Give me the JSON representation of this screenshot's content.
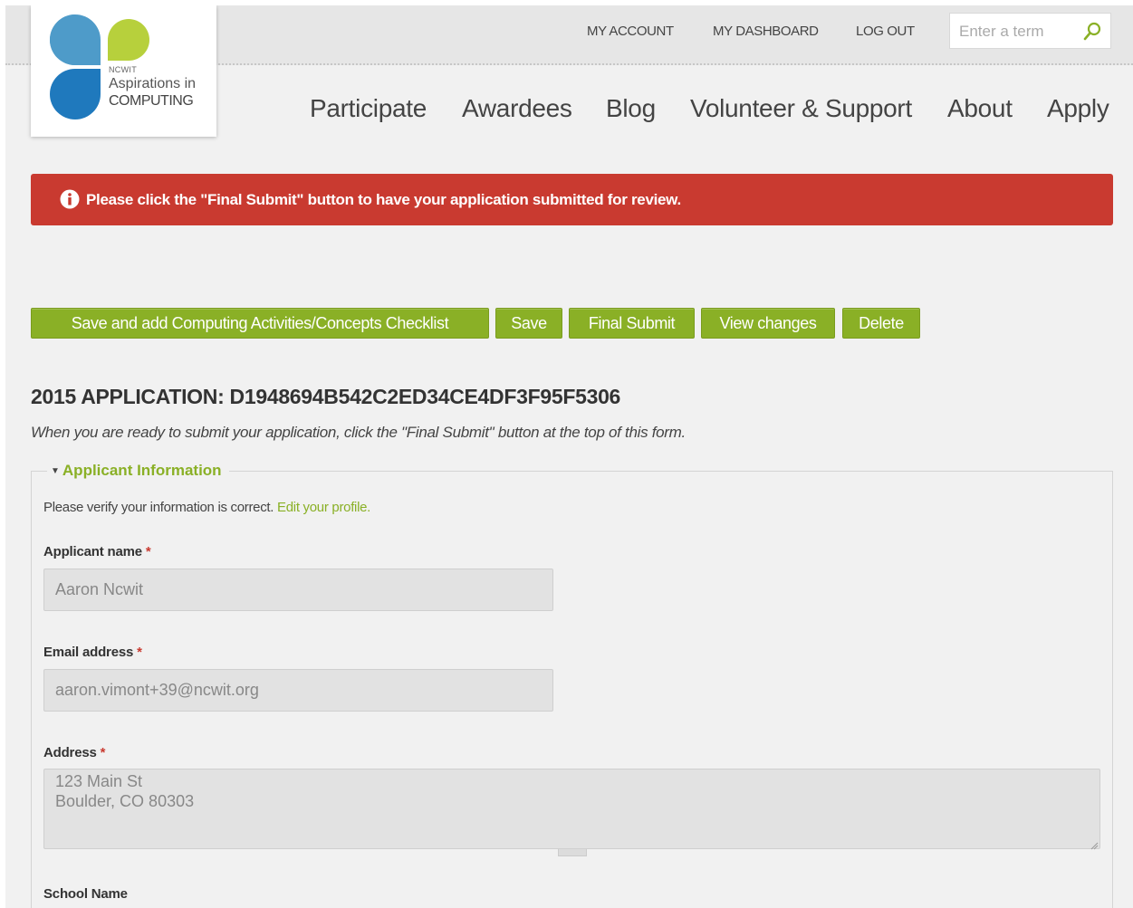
{
  "header": {
    "account_link": "MY ACCOUNT",
    "dashboard_link": "MY DASHBOARD",
    "logout_link": "LOG OUT",
    "search_placeholder": "Enter a term"
  },
  "logo": {
    "org": "NCWIT",
    "line1": "Aspirations in",
    "line2": "COMPUTING",
    "colors": {
      "blue_light": "#4e9bc9",
      "green": "#b7d03c",
      "blue_dark": "#1f79bd"
    }
  },
  "nav": {
    "items": [
      "Participate",
      "Awardees",
      "Blog",
      "Volunteer & Support",
      "About",
      "Apply"
    ]
  },
  "alert": {
    "message": "Please click the \"Final Submit\" button to have your application submitted for review.",
    "color": "#c93a30"
  },
  "actions": {
    "save_checklist": "Save and add Computing Activities/Concepts Checklist",
    "save": "Save",
    "final_submit": "Final Submit",
    "view_changes": "View changes",
    "delete": "Delete",
    "button_color": "#8ab026"
  },
  "application": {
    "title": "2015 APPLICATION: D1948694B542C2ED34CE4DF3F95F5306",
    "instructions": "When you are ready to submit your application, click the \"Final Submit\" button at the top of this form."
  },
  "applicant_info": {
    "legend": "Applicant Information",
    "verify_text": "Please verify your information is correct.",
    "edit_profile_link": "Edit your profile.",
    "name_label": "Applicant name",
    "name_value": "Aaron Ncwit",
    "email_label": "Email address",
    "email_value": "aaron.vimont+39@ncwit.org",
    "address_label": "Address",
    "address_value": "123 Main St\nBoulder, CO 80303",
    "school_label": "School Name",
    "required_marker": "*"
  }
}
